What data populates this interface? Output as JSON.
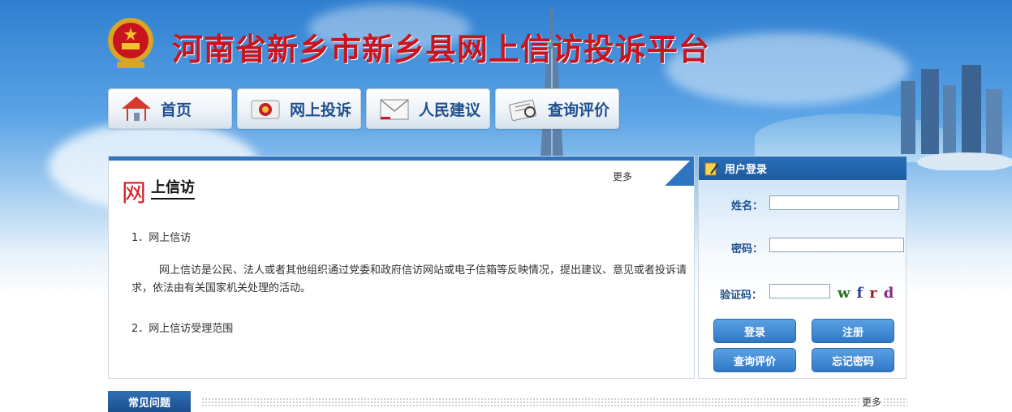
{
  "site_title": "河南省新乡市新乡县网上信访投诉平台",
  "nav": [
    {
      "label": "首页",
      "icon": "home-icon"
    },
    {
      "label": "网上投诉",
      "icon": "complaint-seal-icon"
    },
    {
      "label": "人民建议",
      "icon": "envelope-icon"
    },
    {
      "label": "查询评价",
      "icon": "query-icon"
    }
  ],
  "main": {
    "title_char": "网",
    "title": "上信访",
    "more": "更多",
    "item1": "1．网上信访",
    "paragraph": "网上信访是公民、法人或者其他组织通过党委和政府信访网站或电子信箱等反映情况，提出建议、意见或者投诉请求，依法由有关国家机关处理的活动。",
    "item2": "2．网上信访受理范围"
  },
  "login": {
    "header": "用户登录",
    "name_label": "姓名：",
    "password_label": "密码：",
    "captcha_label": "验证码：",
    "captcha_chars": [
      "w",
      "f",
      "r",
      "d"
    ],
    "login_button": "登录",
    "register_button": "注册",
    "query_button": "查询评价",
    "forgot_button": "忘记密码"
  },
  "faq": {
    "tab": "常见问题",
    "more": "更多"
  },
  "colors": {
    "title_red": "#c8141e",
    "nav_text": "#1f4f8e",
    "accent_blue": "#2f74bf"
  }
}
